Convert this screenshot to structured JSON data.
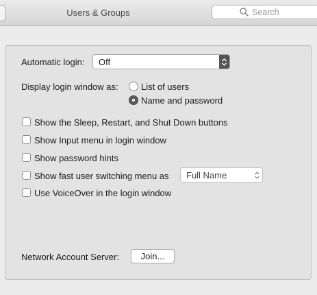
{
  "window": {
    "title": "Users & Groups"
  },
  "search": {
    "placeholder": "Search"
  },
  "login": {
    "automatic_login_label": "Automatic login:",
    "automatic_login_value": "Off",
    "display_as_label": "Display login window as:",
    "display_options": [
      {
        "label": "List of users",
        "selected": false
      },
      {
        "label": "Name and password",
        "selected": true
      }
    ]
  },
  "options": [
    {
      "label": "Show the Sleep, Restart, and Shut Down buttons",
      "checked": false
    },
    {
      "label": "Show Input menu in login window",
      "checked": false
    },
    {
      "label": "Show password hints",
      "checked": false
    },
    {
      "label": "Show fast user switching menu as",
      "checked": false
    },
    {
      "label": "Use VoiceOver in the login window",
      "checked": false
    }
  ],
  "fast_switching": {
    "value": "Full Name"
  },
  "network": {
    "label": "Network Account Server:",
    "join_label": "Join..."
  }
}
